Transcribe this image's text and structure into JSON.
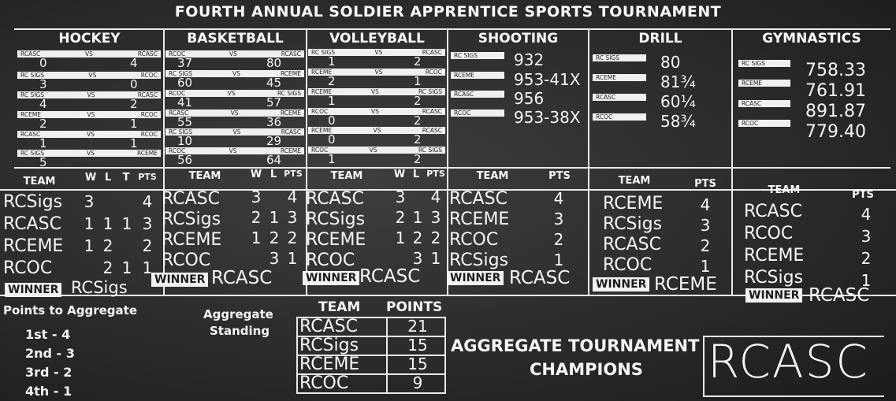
{
  "title": "FOURTH ANNUAL SOLDIER APPRENTICE SPORTS TOURNAMENT",
  "sports": [
    "HOCKEY",
    "BASKETBALL",
    "VOLLEYBALL",
    "SHOOTING",
    "DRILL",
    "GYMNASTICS"
  ],
  "hockey_games": [
    {
      "a": "RCASC",
      "b": "RCASC",
      "sa": "0",
      "sb": "4"
    },
    {
      "a": "RC SIGS",
      "b": "RCOC",
      "sa": "3",
      "sb": "0"
    },
    {
      "a": "RC SIGS",
      "b": "RCASC",
      "sa": "4",
      "sb": "2"
    },
    {
      "a": "RCEME",
      "b": "RCOC",
      "sa": "2",
      "sb": "1"
    },
    {
      "a": "RCASC",
      "b": "RCOC",
      "sa": "1",
      "sb": "1"
    },
    {
      "a": "RC SIGS",
      "b": "RCEME",
      "sa": "5",
      "sb": ""
    }
  ],
  "basketball_games": [
    {
      "a": "RCOC",
      "b": "RCASC",
      "sa": "37",
      "sb": "80"
    },
    {
      "a": "RC SIGS",
      "b": "RCEME",
      "sa": "60",
      "sb": "45"
    },
    {
      "a": "RCOC",
      "b": "RC SIGS",
      "sa": "41",
      "sb": "57"
    },
    {
      "a": "RCASC",
      "b": "RCEME",
      "sa": "55",
      "sb": "36"
    },
    {
      "a": "RC SIGS",
      "b": "RCASC",
      "sa": "10",
      "sb": "29"
    },
    {
      "a": "RCOC",
      "b": "RCEME",
      "sa": "56",
      "sb": "64"
    }
  ],
  "volleyball_games": [
    {
      "a": "RC SIGS",
      "b": "RCASC",
      "sa": "1",
      "sb": "2"
    },
    {
      "a": "RCEME",
      "b": "RCOC",
      "sa": "2",
      "sb": "1"
    },
    {
      "a": "RCEME",
      "b": "RC SIGS",
      "sa": "1",
      "sb": "2"
    },
    {
      "a": "RCOC",
      "b": "RCASC",
      "sa": "0",
      "sb": "2"
    },
    {
      "a": "RCEME",
      "b": "RCASC",
      "sa": "0",
      "sb": "2"
    },
    {
      "a": "RCOC",
      "b": "RC SIGS",
      "sa": "1",
      "sb": "2"
    }
  ],
  "vs": "VS",
  "shooting": [
    {
      "team": "RC SIGS",
      "score": "932"
    },
    {
      "team": "RCEME",
      "score": "953-41X"
    },
    {
      "team": "RCASC",
      "score": "956"
    },
    {
      "team": "RCOC",
      "score": "953-38X"
    }
  ],
  "drill": [
    {
      "team": "RC SIGS",
      "score": "80"
    },
    {
      "team": "RCEME",
      "score": "81¾"
    },
    {
      "team": "RCASC",
      "score": "60¼"
    },
    {
      "team": "RCOC",
      "score": "58¾"
    }
  ],
  "gymnastics": [
    {
      "team": "RC SIGS",
      "score": "758.33"
    },
    {
      "team": "RCEME",
      "score": "761.91"
    },
    {
      "team": "RCASC",
      "score": "891.87"
    },
    {
      "team": "RCOC",
      "score": "779.40"
    }
  ],
  "headers": {
    "team": "TEAM",
    "w": "W",
    "l": "L",
    "t": "T",
    "pts": "PTS",
    "winner": "WINNER"
  },
  "hockey_standings": [
    {
      "team": "RCSigs",
      "w": "3",
      "l": "",
      "t": "",
      "pts": "4"
    },
    {
      "team": "RCASC",
      "w": "1",
      "l": "1",
      "t": "1",
      "pts": "3"
    },
    {
      "team": "RCEME",
      "w": "1",
      "l": "2",
      "t": "",
      "pts": "2"
    },
    {
      "team": "RCOC",
      "w": "",
      "l": "2",
      "t": "1",
      "pts": "1"
    }
  ],
  "basketball_standings": [
    {
      "team": "RCASC",
      "w": "3",
      "l": "",
      "pts": "4"
    },
    {
      "team": "RCSigs",
      "w": "2",
      "l": "1",
      "pts": "3"
    },
    {
      "team": "RCEME",
      "w": "1",
      "l": "2",
      "pts": "2"
    },
    {
      "team": "RCOC",
      "w": "",
      "l": "3",
      "pts": "1"
    }
  ],
  "volleyball_standings": [
    {
      "team": "RCASC",
      "w": "3",
      "l": "",
      "pts": "4"
    },
    {
      "team": "RCSigs",
      "w": "2",
      "l": "1",
      "pts": "3"
    },
    {
      "team": "RCEME",
      "w": "1",
      "l": "2",
      "pts": "2"
    },
    {
      "team": "RCOC",
      "w": "",
      "l": "3",
      "pts": "1"
    }
  ],
  "shooting_standings": [
    {
      "team": "RCASC",
      "pts": "4"
    },
    {
      "team": "RCEME",
      "pts": "3"
    },
    {
      "team": "RCOC",
      "pts": "2"
    },
    {
      "team": "RCSigs",
      "pts": "1"
    }
  ],
  "drill_standings": [
    {
      "team": "RCEME",
      "pts": "4"
    },
    {
      "team": "RCSigs",
      "pts": "3"
    },
    {
      "team": "RCASC",
      "pts": "2"
    },
    {
      "team": "RCOC",
      "pts": "1"
    }
  ],
  "gym_standings": [
    {
      "team": "RCASC",
      "pts": "4"
    },
    {
      "team": "RCOC",
      "pts": "3"
    },
    {
      "team": "RCEME",
      "pts": "2"
    },
    {
      "team": "RCSigs",
      "pts": "1"
    }
  ],
  "winners": {
    "hockey": "RCSigs",
    "basketball": "RCASC",
    "volleyball": "RCASC",
    "shooting": "RCASC",
    "drill": "RCEME",
    "gymnastics": "RCASC"
  },
  "points_title": "Points to Aggregate",
  "points": [
    "1st - 4",
    "2nd - 3",
    "3rd - 2",
    "4th - 1"
  ],
  "aggregate_label": [
    "Aggregate",
    "Standing"
  ],
  "aggregate_headers": {
    "team": "TEAM",
    "points": "POINTS"
  },
  "aggregate": [
    {
      "team": "RCASC",
      "points": "21"
    },
    {
      "team": "RCSigs",
      "points": "15"
    },
    {
      "team": "RCEME",
      "points": "15"
    },
    {
      "team": "RCOC",
      "points": "9"
    }
  ],
  "champions_label": [
    "AGGREGATE TOURNAMENT",
    "CHAMPIONS"
  ],
  "champion": "RCASC"
}
